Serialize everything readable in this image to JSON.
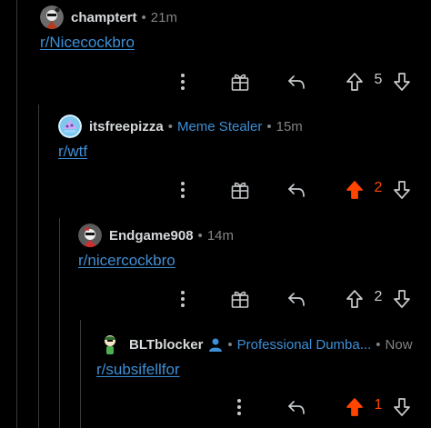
{
  "comments": [
    {
      "username": "champtert",
      "flair": "",
      "time": "21m",
      "body": "r/Nicecockbro",
      "vote_count": "5",
      "upvoted": false
    },
    {
      "username": "itsfreepizza",
      "flair": "Meme Stealer",
      "time": "15m",
      "body": "r/wtf",
      "vote_count": "2",
      "upvoted": true
    },
    {
      "username": "Endgame908",
      "flair": "",
      "time": "14m",
      "body": "r/nicercockbro",
      "vote_count": "2",
      "upvoted": false
    },
    {
      "username": "BLTblocker",
      "flair": "Professional Dumba...",
      "time": "Now",
      "body": "r/subsifellfor",
      "vote_count": "1",
      "upvoted": true
    }
  ],
  "icons": {
    "more": "more-options-icon",
    "award": "award-icon",
    "reply": "reply-icon",
    "upvote": "upvote-arrow-icon",
    "downvote": "downvote-arrow-icon",
    "user": "user-profile-icon"
  },
  "colors": {
    "background": "#000000",
    "link": "#3d8fd6",
    "upvote": "#ff4500",
    "text": "#d7dadc",
    "muted": "#818384",
    "thread_line": "#3a3a3c"
  }
}
